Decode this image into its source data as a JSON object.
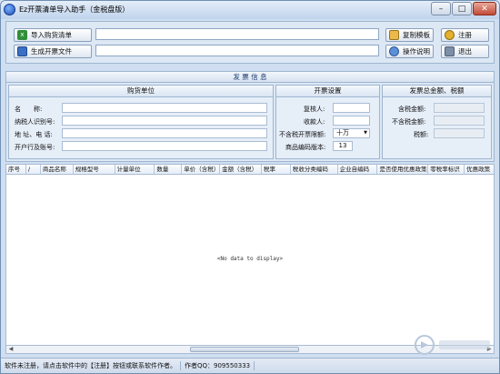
{
  "window": {
    "title": "Ez开票清单导入助手（金税盘版）"
  },
  "toolbar": {
    "import_label": "导入购货清单",
    "import_path": "",
    "generate_label": "生成开票文件",
    "generate_path": "",
    "copy_template_label": "复制模板",
    "register_label": "注册",
    "help_label": "操作说明",
    "exit_label": "退出"
  },
  "invoice_info": {
    "title": "发 票 信 息",
    "buyer": {
      "title": "购货单位",
      "name_label": "名　　称:",
      "taxid_label": "纳税人识别号:",
      "address_label": "地 址、电 话:",
      "bank_label": "开户行及账号:"
    },
    "settings": {
      "title": "开票设置",
      "reviewer_label": "复核人:",
      "payee_label": "收款人:",
      "limit_label": "不含税开票限额:",
      "limit_value": "十万",
      "code_version_label": "商品编码版本:",
      "code_version_value": "13"
    },
    "totals": {
      "title": "发票总金额、税额",
      "with_tax_label": "含税金额:",
      "without_tax_label": "不含税金额:",
      "tax_label": "税额:"
    }
  },
  "grid": {
    "columns": [
      "序号",
      "/",
      "商品名称",
      "规格型号",
      "计量单位",
      "数量",
      "单价（含税）",
      "金额（含税）",
      "税率",
      "税收分类编码",
      "企业自编码",
      "是否使用优惠政策",
      "零税率标识",
      "优惠政策"
    ],
    "empty_text": "<No data to display>"
  },
  "status": {
    "register_hint": "软件未注册，请点击软件中的【注册】按钮或联系软件作者。",
    "author_qq": "作者QQ：909550333"
  },
  "colors": {
    "accent": "#1a4fb5",
    "excel_green": "#2f8f3a",
    "close_red": "#c24b37"
  },
  "icons": [
    "excel-icon",
    "save-icon",
    "copy-template-icon",
    "key-icon",
    "help-icon",
    "exit-icon",
    "app-icon"
  ]
}
